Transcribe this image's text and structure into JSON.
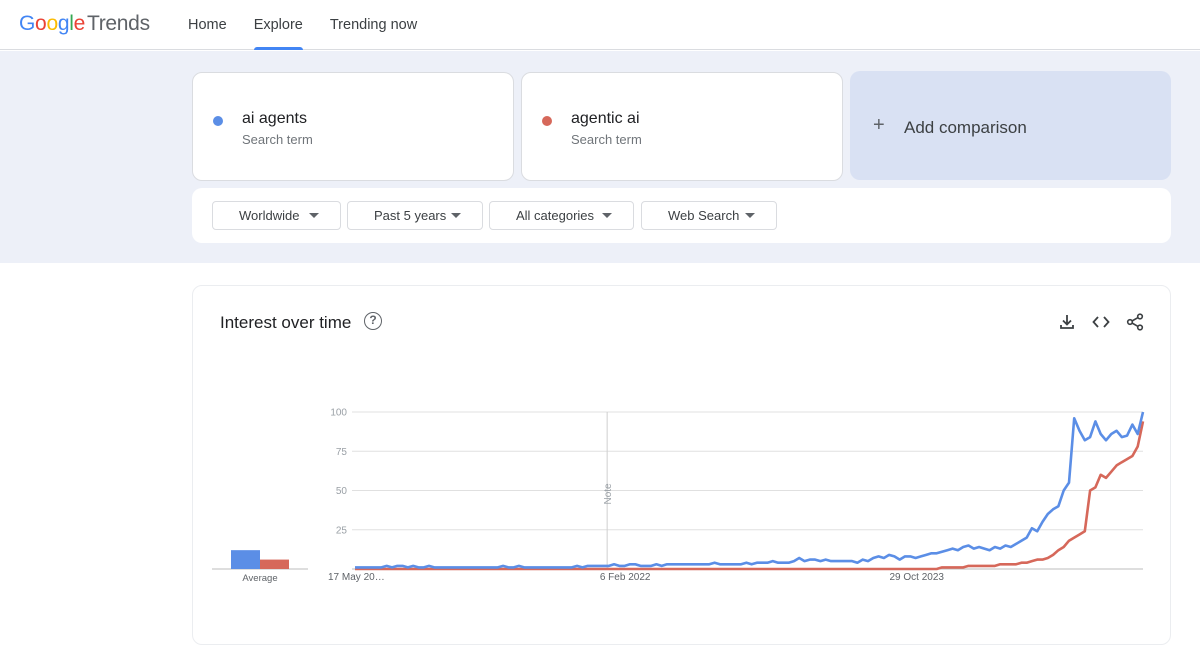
{
  "header": {
    "logo_google": [
      "G",
      "o",
      "o",
      "g",
      "l",
      "e"
    ],
    "logo_trends": "Trends",
    "nav": [
      {
        "label": "Home",
        "active": false
      },
      {
        "label": "Explore",
        "active": true
      },
      {
        "label": "Trending now",
        "active": false
      }
    ]
  },
  "search_terms": [
    {
      "term": "ai agents",
      "type": "Search term",
      "color": "#5b8ee6"
    },
    {
      "term": "agentic ai",
      "type": "Search term",
      "color": "#d6685a"
    }
  ],
  "add_comparison": {
    "icon": "plus-icon",
    "label": "Add comparison"
  },
  "filters": {
    "region": "Worldwide",
    "time": "Past 5 years",
    "category": "All categories",
    "search_type": "Web Search"
  },
  "card": {
    "title": "Interest over time",
    "help_icon": "?",
    "tools": [
      "download-icon",
      "embed-code-icon",
      "share-icon"
    ]
  },
  "chart_data": {
    "type": "line",
    "ylim": [
      0,
      100
    ],
    "y_ticks": [
      "100",
      "75",
      "50",
      "25"
    ],
    "x_tick_labels": [
      "17 May 20…",
      "6 Feb 2022",
      "29 Oct 2023"
    ],
    "x_tick_positions": [
      0,
      0.32,
      0.69
    ],
    "note_label": "Note",
    "note_position": 0.32,
    "average_label": "Average",
    "average_values": [
      12,
      6
    ],
    "series": [
      {
        "name": "ai agents",
        "color": "#5b8ee6",
        "values": [
          1,
          1,
          1,
          1,
          1,
          1,
          2,
          1,
          2,
          2,
          1,
          2,
          1,
          1,
          2,
          1,
          1,
          1,
          1,
          1,
          1,
          1,
          1,
          1,
          1,
          1,
          1,
          1,
          2,
          1,
          1,
          2,
          1,
          1,
          1,
          1,
          1,
          1,
          1,
          1,
          1,
          1,
          2,
          1,
          2,
          2,
          2,
          2,
          2,
          3,
          2,
          2,
          3,
          3,
          2,
          2,
          2,
          3,
          2,
          3,
          3,
          3,
          3,
          3,
          3,
          3,
          3,
          3,
          4,
          3,
          3,
          3,
          3,
          3,
          4,
          3,
          4,
          4,
          4,
          5,
          4,
          4,
          4,
          5,
          7,
          5,
          6,
          6,
          5,
          6,
          5,
          5,
          5,
          5,
          5,
          4,
          6,
          5,
          7,
          8,
          7,
          9,
          8,
          6,
          8,
          8,
          7,
          8,
          9,
          10,
          10,
          11,
          12,
          13,
          12,
          14,
          15,
          13,
          14,
          13,
          12,
          14,
          13,
          15,
          14,
          16,
          18,
          20,
          26,
          24,
          30,
          35,
          38,
          40,
          50,
          55,
          96,
          88,
          82,
          84,
          94,
          86,
          82,
          86,
          88,
          84,
          85,
          92,
          86,
          100
        ]
      },
      {
        "name": "agentic ai",
        "color": "#d6685a",
        "values": [
          0,
          0,
          0,
          0,
          0,
          0,
          0,
          0,
          0,
          0,
          0,
          0,
          0,
          0,
          0,
          0,
          0,
          0,
          0,
          0,
          0,
          0,
          0,
          0,
          0,
          0,
          0,
          0,
          0,
          0,
          0,
          0,
          0,
          0,
          0,
          0,
          0,
          0,
          0,
          0,
          0,
          0,
          0,
          0,
          0,
          0,
          0,
          0,
          0,
          0,
          0,
          0,
          0,
          0,
          0,
          0,
          0,
          0,
          0,
          0,
          0,
          0,
          0,
          0,
          0,
          0,
          0,
          0,
          0,
          0,
          0,
          0,
          0,
          0,
          0,
          0,
          0,
          0,
          0,
          0,
          0,
          0,
          0,
          0,
          0,
          0,
          0,
          0,
          0,
          0,
          0,
          0,
          0,
          0,
          0,
          0,
          0,
          0,
          0,
          0,
          0,
          0,
          0,
          0,
          0,
          0,
          0,
          0,
          0,
          0,
          0,
          1,
          1,
          1,
          1,
          1,
          2,
          2,
          2,
          2,
          2,
          2,
          3,
          3,
          3,
          3,
          4,
          4,
          5,
          6,
          6,
          7,
          9,
          12,
          14,
          18,
          20,
          22,
          24,
          50,
          52,
          60,
          58,
          62,
          66,
          68,
          70,
          72,
          78,
          94
        ]
      }
    ]
  }
}
